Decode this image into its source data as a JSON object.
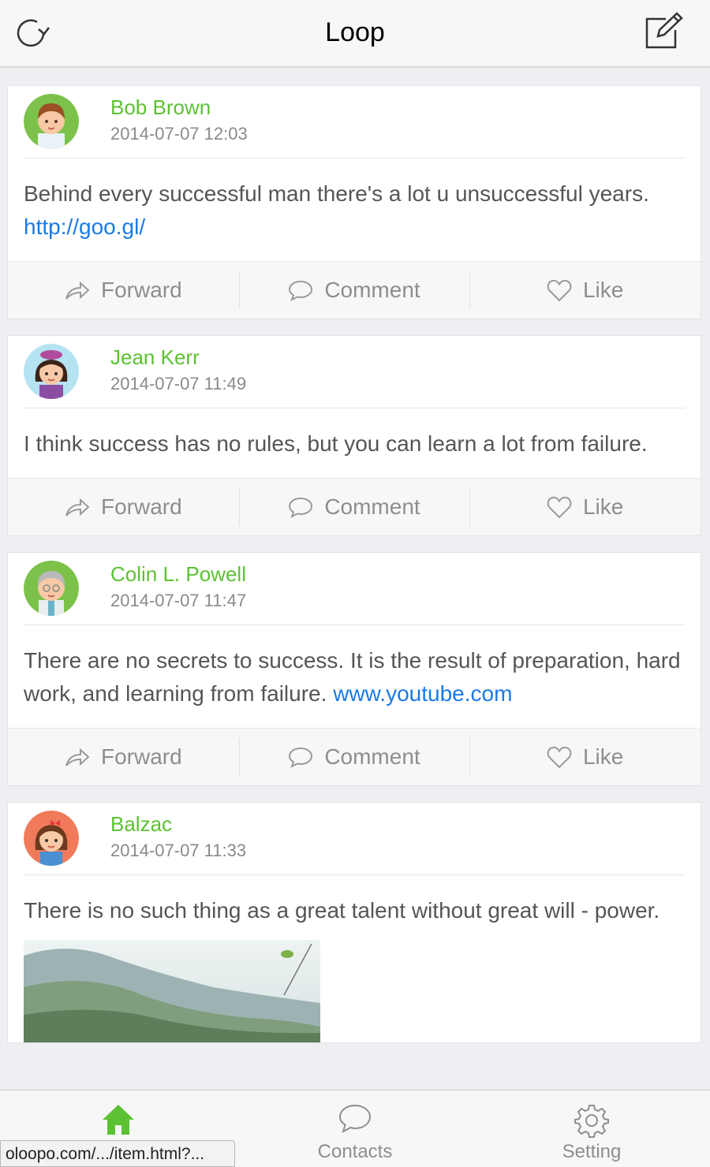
{
  "header": {
    "title": "Loop"
  },
  "posts": [
    {
      "author": "Bob Brown",
      "date": "2014-07-07 12:03",
      "text": "Behind every successful man there's a lot u unsuccessful years. ",
      "link": "http://goo.gl/"
    },
    {
      "author": "Jean Kerr",
      "date": "2014-07-07 11:49",
      "text": "I think success has no rules, but you can learn a lot from failure.",
      "link": ""
    },
    {
      "author": "Colin L. Powell",
      "date": "2014-07-07 11:47",
      "text": "There are no secrets to success. It is the result of preparation, hard work, and learning from failure. ",
      "link": "www.youtube.com"
    },
    {
      "author": "Balzac",
      "date": "2014-07-07 11:33",
      "text": "There is no such thing as a great talent without great will - power.",
      "link": ""
    }
  ],
  "actions": {
    "forward": "Forward",
    "comment": "Comment",
    "like": "Like"
  },
  "tabbar": {
    "home_label": "",
    "contacts_label": "Contacts",
    "setting_label": "Setting",
    "active_color": "#5cc233"
  },
  "status_url": "oloopo.com/.../item.html?..."
}
